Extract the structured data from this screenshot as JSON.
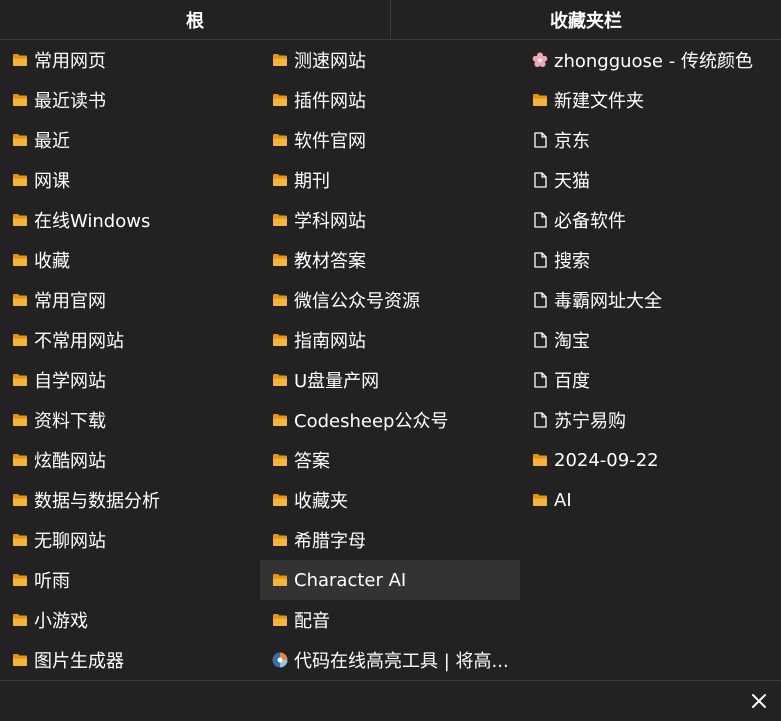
{
  "tabs": [
    "根",
    "收藏夹栏"
  ],
  "columns": [
    [
      {
        "label": "常用网页",
        "icon": "folder-icon"
      },
      {
        "label": "最近读书",
        "icon": "folder-icon"
      },
      {
        "label": "最近",
        "icon": "folder-icon"
      },
      {
        "label": "网课",
        "icon": "folder-icon"
      },
      {
        "label": "在线Windows",
        "icon": "folder-icon"
      },
      {
        "label": "收藏",
        "icon": "folder-icon"
      },
      {
        "label": "常用官网",
        "icon": "folder-icon"
      },
      {
        "label": "不常用网站",
        "icon": "folder-icon"
      },
      {
        "label": "自学网站",
        "icon": "folder-icon"
      },
      {
        "label": "资料下载",
        "icon": "folder-icon"
      },
      {
        "label": "炫酷网站",
        "icon": "folder-icon"
      },
      {
        "label": "数据与数据分析",
        "icon": "folder-icon"
      },
      {
        "label": "无聊网站",
        "icon": "folder-icon"
      },
      {
        "label": "听雨",
        "icon": "folder-icon"
      },
      {
        "label": "小游戏",
        "icon": "folder-icon"
      },
      {
        "label": "图片生成器",
        "icon": "folder-icon"
      }
    ],
    [
      {
        "label": "测速网站",
        "icon": "folder-icon"
      },
      {
        "label": "插件网站",
        "icon": "folder-icon"
      },
      {
        "label": "软件官网",
        "icon": "folder-icon"
      },
      {
        "label": "期刊",
        "icon": "folder-icon"
      },
      {
        "label": "学科网站",
        "icon": "folder-icon"
      },
      {
        "label": "教材答案",
        "icon": "folder-icon"
      },
      {
        "label": "微信公众号资源",
        "icon": "folder-icon"
      },
      {
        "label": "指南网站",
        "icon": "folder-icon"
      },
      {
        "label": "U盘量产网",
        "icon": "folder-icon"
      },
      {
        "label": "Codesheep公众号",
        "icon": "folder-icon"
      },
      {
        "label": "答案",
        "icon": "folder-icon"
      },
      {
        "label": "收藏夹",
        "icon": "folder-icon"
      },
      {
        "label": "希腊字母",
        "icon": "folder-icon"
      },
      {
        "label": "Character AI",
        "icon": "folder-icon",
        "hover": true
      },
      {
        "label": "配音",
        "icon": "folder-icon"
      },
      {
        "label": "代码在线高亮工具 | 将高...",
        "icon": "site-favicon-icon"
      }
    ],
    [
      {
        "label": "zhongguose - 传统颜色",
        "icon": "flower-favicon-icon"
      },
      {
        "label": "新建文件夹",
        "icon": "folder-icon"
      },
      {
        "label": "京东",
        "icon": "page-icon"
      },
      {
        "label": "天猫",
        "icon": "page-icon"
      },
      {
        "label": "必备软件",
        "icon": "page-icon"
      },
      {
        "label": "搜索",
        "icon": "page-icon"
      },
      {
        "label": "毒霸网址大全",
        "icon": "page-icon"
      },
      {
        "label": "淘宝",
        "icon": "page-icon"
      },
      {
        "label": "百度",
        "icon": "page-icon"
      },
      {
        "label": "苏宁易购",
        "icon": "page-icon"
      },
      {
        "label": "2024-09-22",
        "icon": "folder-icon"
      },
      {
        "label": "AI",
        "icon": "folder-icon"
      }
    ]
  ],
  "colors": {
    "background": "#222222",
    "folder": "#f5a623",
    "hover": "#333333",
    "divider": "#3a3a3a"
  }
}
